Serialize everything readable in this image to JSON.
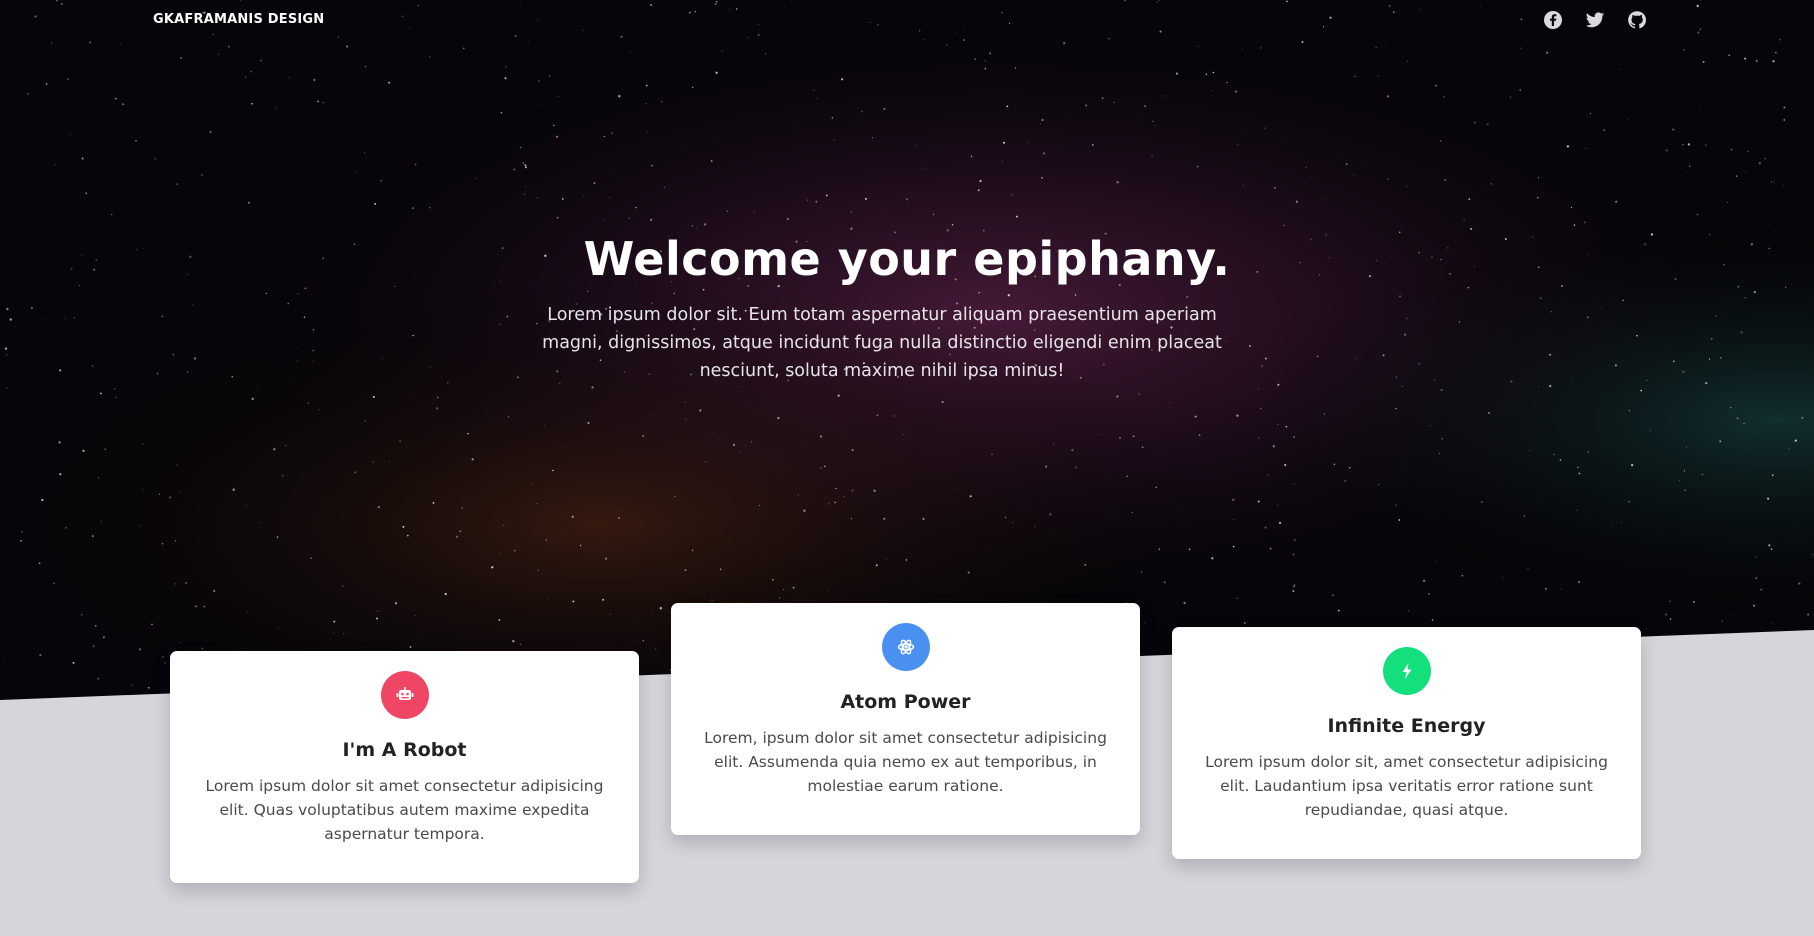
{
  "brand": "GKAFRAMANIS DESIGN",
  "social": {
    "facebook": "facebook-icon",
    "twitter": "twitter-icon",
    "github": "github-icon"
  },
  "hero": {
    "title": "Welcome your epiphany.",
    "text": "Lorem ipsum dolor sit. Eum totam aspernatur aliquam praesentium aperiam magni, dignissimos, atque incidunt fuga nulla distinctio eligendi enim placeat nesciunt, soluta maxime nihil ipsa minus!"
  },
  "cards": [
    {
      "icon": "robot-icon",
      "color": "#f04666",
      "title": "I'm A Robot",
      "text": "Lorem ipsum dolor sit amet consectetur adipisicing elit. Quas voluptatibus autem maxime expedita aspernatur tempora."
    },
    {
      "icon": "atom-icon",
      "color": "#4a90f0",
      "title": "Atom Power",
      "text": "Lorem, ipsum dolor sit amet consectetur adipisicing elit. Assumenda quia nemo ex aut temporibus, in molestiae earum ratione."
    },
    {
      "icon": "bolt-icon",
      "color": "#13e07d",
      "title": "Infinite Energy",
      "text": "Lorem ipsum dolor sit, amet consectetur adipisicing elit. Laudantium ipsa veritatis error ratione sunt repudiandae, quasi atque."
    }
  ],
  "colors": {
    "background": "#d6d5da",
    "hero": "#07060a",
    "card": "#ffffff"
  }
}
